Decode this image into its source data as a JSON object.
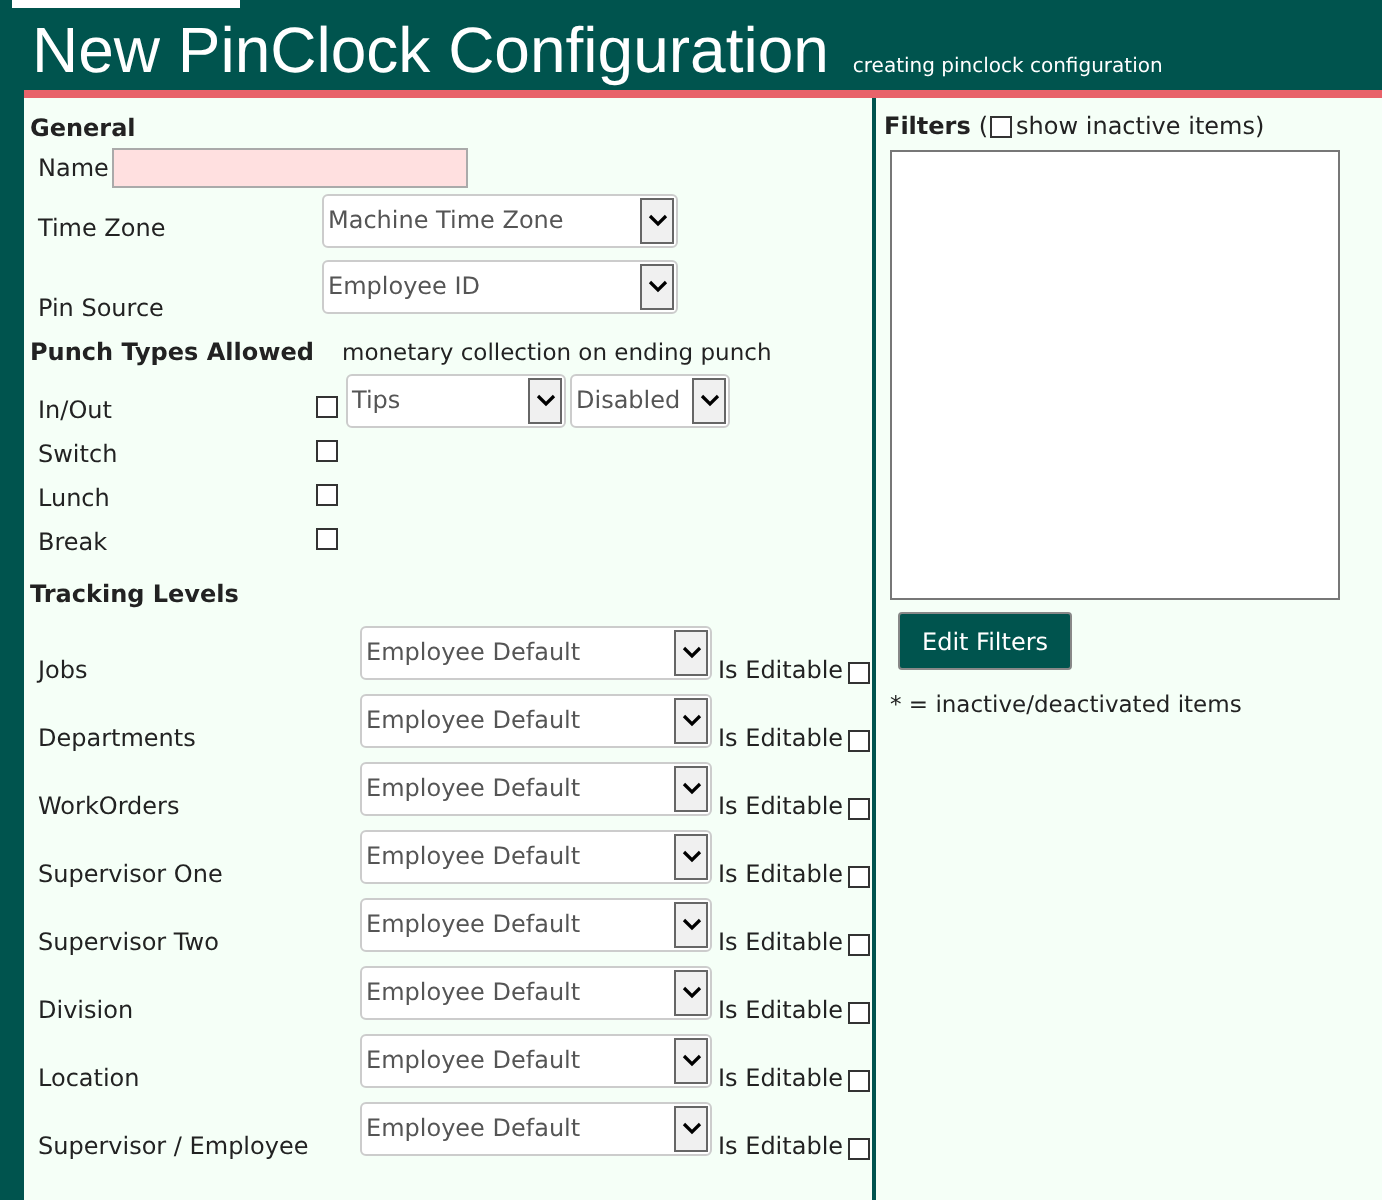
{
  "header": {
    "title": "New PinClock Configuration",
    "subtitle": "creating pinclock configuration"
  },
  "general": {
    "heading": "General",
    "name": {
      "label": "Name"
    },
    "time_zone": {
      "label": "Time Zone",
      "value": "Machine Time Zone"
    },
    "pin_source": {
      "label": "Pin Source",
      "value": "Employee ID"
    }
  },
  "punch_types": {
    "heading": "Punch Types Allowed",
    "note": "monetary collection on ending punch",
    "items": [
      {
        "label": "In/Out",
        "checked": false
      },
      {
        "label": "Switch",
        "checked": false
      },
      {
        "label": "Lunch",
        "checked": false
      },
      {
        "label": "Break",
        "checked": false
      }
    ],
    "collection_type": "Tips",
    "collection_state": "Disabled"
  },
  "tracking": {
    "heading": "Tracking Levels",
    "items": [
      {
        "label": "Jobs",
        "value": "Employee Default",
        "editable_label": "Is Editable",
        "editable": false
      },
      {
        "label": "Departments",
        "value": "Employee Default",
        "editable_label": "Is Editable",
        "editable": false
      },
      {
        "label": "WorkOrders",
        "value": "Employee Default",
        "editable_label": "Is Editable",
        "editable": false
      },
      {
        "label": "Supervisor One",
        "value": "Employee Default",
        "editable_label": "Is Editable",
        "editable": false
      },
      {
        "label": "Supervisor Two",
        "value": "Employee Default",
        "editable_label": "Is Editable",
        "editable": false
      },
      {
        "label": "Division",
        "value": "Employee Default",
        "editable_label": "Is Editable",
        "editable": false
      },
      {
        "label": "Location",
        "value": "Employee Default",
        "editable_label": "Is Editable",
        "editable": false
      },
      {
        "label": "Supervisor / Employee",
        "value": "Employee Default",
        "editable_label": "Is Editable",
        "editable": false
      }
    ]
  },
  "filters": {
    "heading": "Filters",
    "open_paren": "(",
    "show_inactive_label": "show inactive items)",
    "show_inactive": false,
    "button": "Edit Filters",
    "footnote": "* = inactive/deactivated items"
  }
}
